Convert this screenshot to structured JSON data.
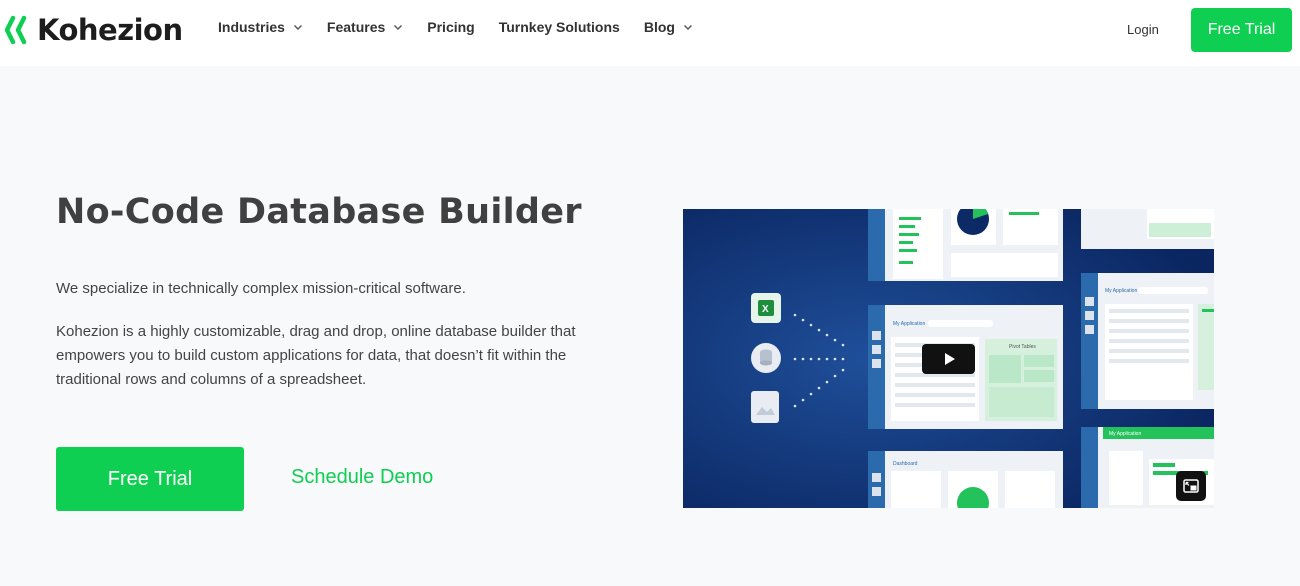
{
  "brand": {
    "name": "Kohezion",
    "accent": "#0fcf52"
  },
  "nav": {
    "items": [
      {
        "label": "Industries",
        "has_dropdown": true
      },
      {
        "label": "Features",
        "has_dropdown": true
      },
      {
        "label": "Pricing",
        "has_dropdown": false
      },
      {
        "label": "Turnkey Solutions",
        "has_dropdown": false
      },
      {
        "label": "Blog",
        "has_dropdown": true
      }
    ],
    "login_label": "Login",
    "trial_label": "Free Trial"
  },
  "hero": {
    "title": "No-Code Database Builder",
    "tagline": "We specialize in technically complex mission-critical software.",
    "description": "Kohezion is a highly customizable, drag and drop, online database builder that empowers you to build custom applications for data, that doesn’t fit within the traditional rows and columns of a spreadsheet.",
    "primary_cta": "Free Trial",
    "secondary_cta": "Schedule Demo"
  },
  "video": {
    "icons": [
      "play-icon",
      "picture-in-picture-icon",
      "excel-file-icon",
      "database-icon",
      "image-file-icon"
    ],
    "screen_labels": [
      "My Application",
      "Pivot Tables",
      "My Application",
      "My Application",
      "Dashboard"
    ]
  }
}
